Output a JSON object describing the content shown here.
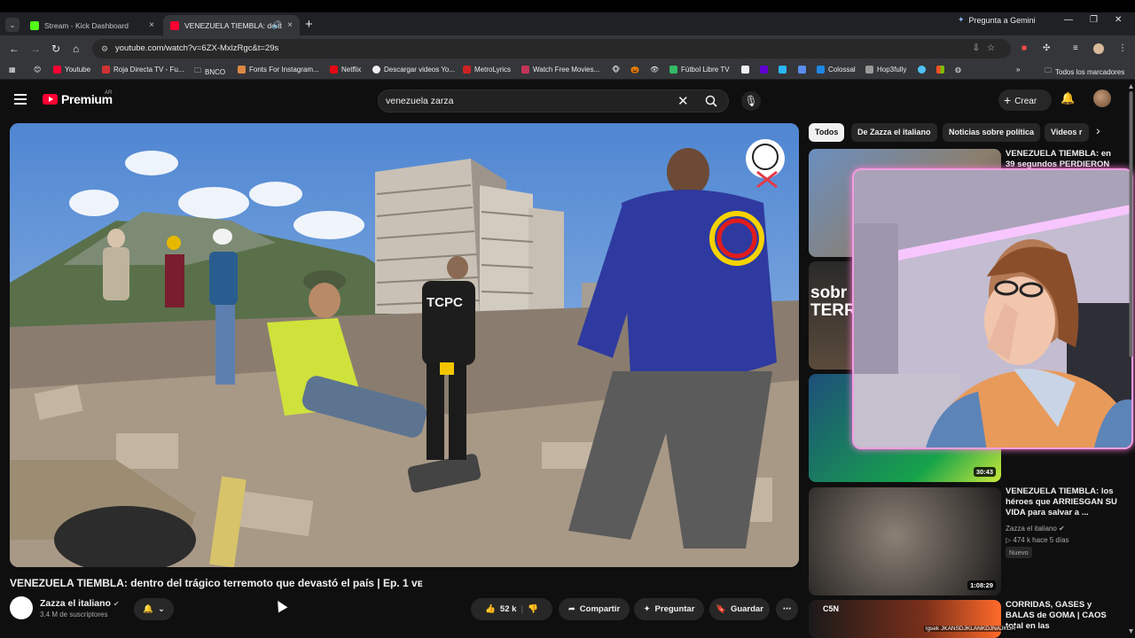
{
  "browser": {
    "tabs": [
      {
        "title": "Stream - Kick Dashboard",
        "close": "×"
      },
      {
        "title": "VENEZUELA TIEMBLA: dent",
        "close": "×"
      }
    ],
    "new_tab": "+",
    "gemini": "Pregunta a Gemini",
    "url": "youtube.com/watch?v=6ZX-MxlzRgc&t=29s",
    "bookmarks": [
      "Youtube",
      "Roja Directa TV - Fu...",
      "BNCO",
      "Fonts For Instagram...",
      "Netflix",
      "Descargar videos Yo...",
      "MetroLyrics",
      "Watch Free Movies...",
      "Fútbol Libre TV",
      "Colossal",
      "Hop3fully"
    ],
    "all_bookmarks": "Todos los marcadores"
  },
  "youtube": {
    "logo": "Premium",
    "region": "AR",
    "search_query": "venezuela zarza",
    "create_label": "Crear"
  },
  "video": {
    "title": "VENEZUELA TIEMBLA: dentro del trágico terremoto que devastó el país | Ep. 1 ᴠᴇ",
    "channel": "Zazza el italiano",
    "subscribers": "3.4 M de suscriptores",
    "likes": "52 k",
    "share": "Compartir",
    "ask": "Preguntar",
    "save": "Guardar",
    "vest_text": "TCPC"
  },
  "chips": [
    "Todos",
    "De Zazza el italiano",
    "Noticias sobre política",
    "Videos r"
  ],
  "related": [
    {
      "title": "VENEZUELA TIEMBLA: en 39 segundos PERDIERON",
      "duration": "",
      "channel": "",
      "meta": "",
      "badge": ""
    },
    {
      "title": "",
      "duration": "",
      "thumb_text": "sobr TERREM"
    },
    {
      "title": "",
      "duration": "30:43"
    },
    {
      "title": "VENEZUELA TIEMBLA: los héroes que ARRIESGAN SU VIDA para salvar a ...",
      "duration": "1:08:29",
      "channel": "Zazza el italiano",
      "meta": "474 k  hace 5 días",
      "badge": "Nuevo"
    },
    {
      "title": "CORRIDAS, GASES y BALAS de GOMA | CAOS total en las",
      "duration": "",
      "thumb_text": "C5N"
    }
  ],
  "overlay_text": "lgsek  JKANSDJKLANKDJNAJKDA"
}
